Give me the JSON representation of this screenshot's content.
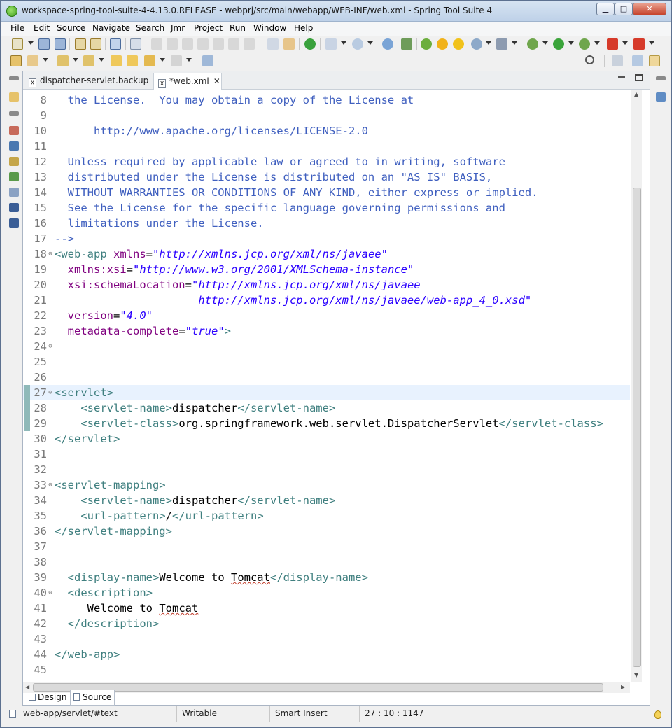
{
  "window": {
    "title": "workspace-spring-tool-suite-4-4.13.0.RELEASE - webprj/src/main/webapp/WEB-INF/web.xml - Spring Tool Suite 4",
    "minimize_label": "▁",
    "maximize_label": "□",
    "close_label": "✕"
  },
  "menu": [
    "File",
    "Edit",
    "Source",
    "Navigate",
    "Search",
    "Jmr",
    "Project",
    "Run",
    "Window",
    "Help"
  ],
  "tabs": [
    {
      "label": "dispatcher-servlet.backup",
      "icon": "xml-file-icon"
    },
    {
      "label": "*web.xml",
      "icon": "xml-file-icon",
      "close": "✕"
    }
  ],
  "editor": {
    "lines": [
      {
        "n": "8",
        "fold": "",
        "html": "<span class=\"c\">the License.  You may obtain a copy of the License at</span>",
        "indent": "  "
      },
      {
        "n": "9",
        "fold": "",
        "html": "",
        "indent": ""
      },
      {
        "n": "10",
        "fold": "",
        "html": "<span class=\"c\">http://www.apache.org/licenses/LICENSE-2.0</span>",
        "indent": "      "
      },
      {
        "n": "11",
        "fold": "",
        "html": "",
        "indent": ""
      },
      {
        "n": "12",
        "fold": "",
        "html": "<span class=\"c\">Unless required by applicable law or agreed to in writing, software</span>",
        "indent": "  "
      },
      {
        "n": "13",
        "fold": "",
        "html": "<span class=\"c\">distributed under the License is distributed on an \"AS IS\" BASIS,</span>",
        "indent": "  "
      },
      {
        "n": "14",
        "fold": "",
        "html": "<span class=\"c\">WITHOUT WARRANTIES OR CONDITIONS OF ANY KIND, either express or implied.</span>",
        "indent": "  "
      },
      {
        "n": "15",
        "fold": "",
        "html": "<span class=\"c\">See the License for the specific language governing permissions and</span>",
        "indent": "  "
      },
      {
        "n": "16",
        "fold": "",
        "html": "<span class=\"c\">limitations under the License.</span>",
        "indent": "  "
      },
      {
        "n": "17",
        "fold": "",
        "html": "<span class=\"c\">--&gt;</span>",
        "indent": ""
      },
      {
        "n": "18",
        "fold": "⊖",
        "html": "<span class=\"t\">&lt;web-app</span> <span class=\"a\">xmlns</span><span class=\"p\">=</span><span class=\"v\">\"http://xmlns.jcp.org/xml/ns/javaee\"</span>",
        "indent": ""
      },
      {
        "n": "19",
        "fold": "",
        "html": "<span class=\"a\">xmlns:xsi</span><span class=\"p\">=</span><span class=\"v\">\"http://www.w3.org/2001/XMLSchema-instance\"</span>",
        "indent": "  "
      },
      {
        "n": "20",
        "fold": "",
        "html": "<span class=\"a\">xsi:schemaLocation</span><span class=\"p\">=</span><span class=\"v\">\"http://xmlns.jcp.org/xml/ns/javaee</span>",
        "indent": "  "
      },
      {
        "n": "21",
        "fold": "",
        "html": "<span class=\"v\">http://xmlns.jcp.org/xml/ns/javaee/web-app_4_0.xsd\"</span>",
        "indent": "                      "
      },
      {
        "n": "22",
        "fold": "",
        "html": "<span class=\"a\">version</span><span class=\"p\">=</span><span class=\"v\">\"4.0\"</span>",
        "indent": "  "
      },
      {
        "n": "23",
        "fold": "",
        "html": "<span class=\"a\">metadata-complete</span><span class=\"p\">=</span><span class=\"v\">\"true\"</span><span class=\"t\">&gt;</span>",
        "indent": "  "
      },
      {
        "n": "24",
        "fold": "⊖",
        "html": "",
        "indent": ""
      },
      {
        "n": "25",
        "fold": "",
        "html": "",
        "indent": ""
      },
      {
        "n": "26",
        "fold": "",
        "html": "",
        "indent": ""
      },
      {
        "n": "27",
        "fold": "⊖",
        "html": "<span class=\"t\">&lt;servlet&gt;</span>",
        "indent": "",
        "current": true
      },
      {
        "n": "28",
        "fold": "",
        "html": "<span class=\"t\">&lt;servlet-name&gt;</span><span class=\"p\">dispatcher</span><span class=\"t\">&lt;/servlet-name&gt;</span>",
        "indent": "    "
      },
      {
        "n": "29",
        "fold": "",
        "html": "<span class=\"t\">&lt;servlet-class&gt;</span><span class=\"p\">org.springframework.web.servlet.DispatcherServlet</span><span class=\"t\">&lt;/servlet-class&gt;</span>",
        "indent": "    "
      },
      {
        "n": "30",
        "fold": "",
        "html": "<span class=\"t\">&lt;/servlet&gt;</span>",
        "indent": ""
      },
      {
        "n": "31",
        "fold": "",
        "html": "",
        "indent": ""
      },
      {
        "n": "32",
        "fold": "",
        "html": "",
        "indent": ""
      },
      {
        "n": "33",
        "fold": "⊖",
        "html": "<span class=\"t\">&lt;servlet-mapping&gt;</span>",
        "indent": ""
      },
      {
        "n": "34",
        "fold": "",
        "html": "<span class=\"t\">&lt;servlet-name&gt;</span><span class=\"p\">dispatcher</span><span class=\"t\">&lt;/servlet-name&gt;</span>",
        "indent": "    "
      },
      {
        "n": "35",
        "fold": "",
        "html": "<span class=\"t\">&lt;url-pattern&gt;</span><span class=\"p\">/</span><span class=\"t\">&lt;/url-pattern&gt;</span>",
        "indent": "    "
      },
      {
        "n": "36",
        "fold": "",
        "html": "<span class=\"t\">&lt;/servlet-mapping&gt;</span>",
        "indent": ""
      },
      {
        "n": "37",
        "fold": "",
        "html": "",
        "indent": ""
      },
      {
        "n": "38",
        "fold": "",
        "html": "",
        "indent": ""
      },
      {
        "n": "39",
        "fold": "",
        "html": "<span class=\"t\">&lt;display-name&gt;</span><span class=\"p\">Welcome to <span class=\"sq\">Tomcat</span></span><span class=\"t\">&lt;/display-name&gt;</span>",
        "indent": "  "
      },
      {
        "n": "40",
        "fold": "⊖",
        "html": "<span class=\"t\">&lt;description&gt;</span>",
        "indent": "  "
      },
      {
        "n": "41",
        "fold": "",
        "html": "<span class=\"p\">Welcome to <span class=\"sq\">Tomcat</span></span>",
        "indent": "     "
      },
      {
        "n": "42",
        "fold": "",
        "html": "<span class=\"t\">&lt;/description&gt;</span>",
        "indent": "  "
      },
      {
        "n": "43",
        "fold": "",
        "html": "",
        "indent": ""
      },
      {
        "n": "44",
        "fold": "",
        "html": "<span class=\"t\">&lt;/web-app&gt;</span>",
        "indent": ""
      },
      {
        "n": "45",
        "fold": "",
        "html": "",
        "indent": ""
      }
    ]
  },
  "bottom_tabs": {
    "design": "Design",
    "source": "Source"
  },
  "status": {
    "path": "web-app/servlet/#text",
    "writable": "Writable",
    "insert_mode": "Smart Insert",
    "position": "27 : 10 : 1147"
  },
  "colors": {
    "tag": "#3f7f7f",
    "attribute": "#7f007f",
    "value": "#2a00ff",
    "comment": "#3f5fbf",
    "current_line": "#e8f2fe"
  }
}
